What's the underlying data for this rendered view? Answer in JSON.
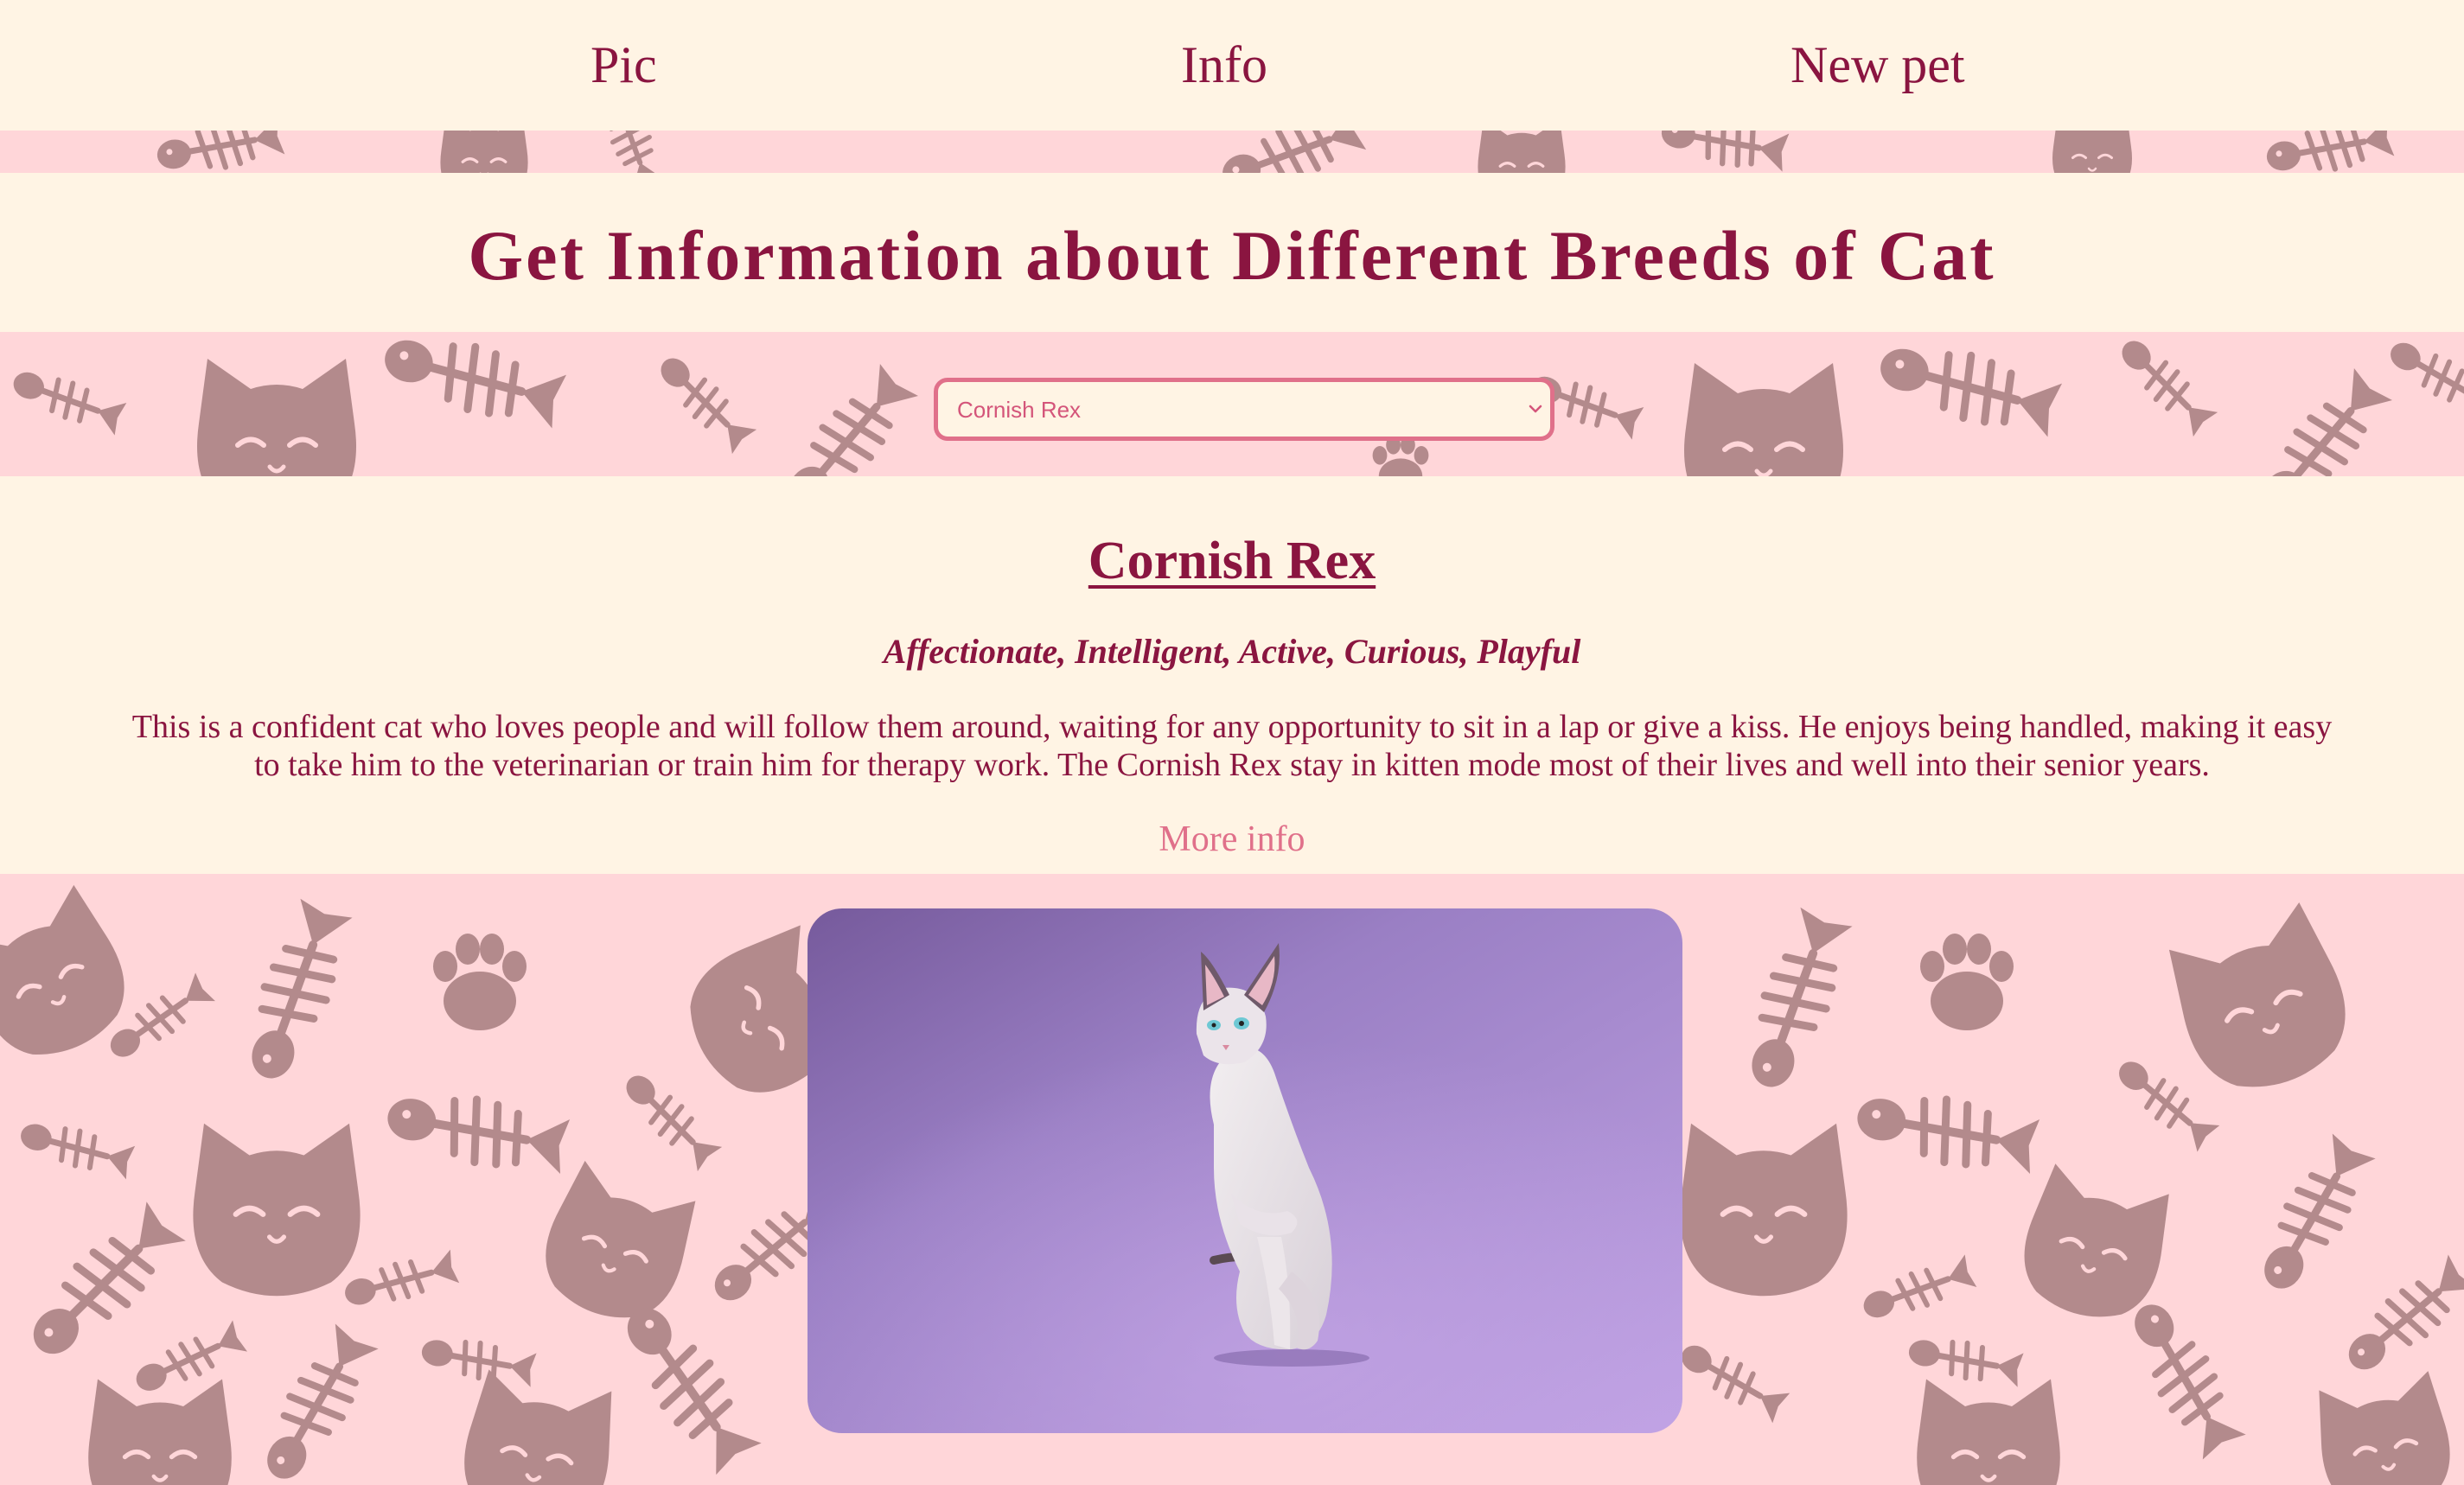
{
  "nav": {
    "pic_label": "Pic",
    "info_label": "Info",
    "new_pet_label": "New pet"
  },
  "header": {
    "title": "Get Information about Different Breeds of Cat"
  },
  "breed_select": {
    "selected": "Cornish Rex"
  },
  "breed": {
    "name": "Cornish Rex",
    "temperament": "Affectionate, Intelligent, Active, Curious, Playful",
    "description": "This is a confident cat who loves people and will follow them around, waiting for any opportunity to sit in a lap or give a kiss. He enjoys being handled, making it easy to take him to the veterinarian or train him for therapy work. The Cornish Rex stay in kitten mode most of their lives and well into their senior years.",
    "more_info_label": "More info"
  },
  "colors": {
    "cream": "#fff4e4",
    "pink_background": "#ffd6d9",
    "pattern": "#b38a8c",
    "text_primary": "#8a1540",
    "accent_pink": "#e0708a",
    "photo_purple": "#a48ad0"
  },
  "icons": {
    "pattern_motifs": [
      "cat-face-icon",
      "fish-skeleton-icon",
      "paw-print-icon"
    ],
    "select_arrow": "chevron-down-icon"
  }
}
